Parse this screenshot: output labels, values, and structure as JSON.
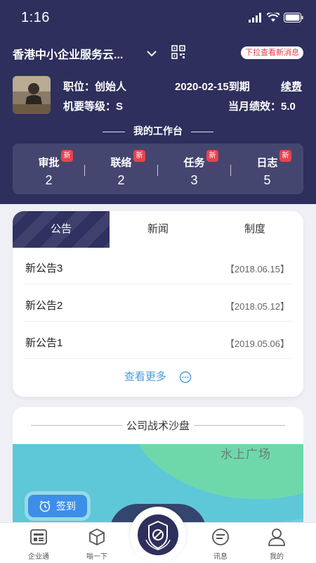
{
  "status_bar": {
    "time": "1:16"
  },
  "header": {
    "company_name": "香港中小企业服务云...",
    "pull_hint": "下拉查看新消息",
    "position_label": "职位：创始人",
    "expiry": "2020-02-15到期",
    "renew": "续费",
    "level_label": "机要等级：S",
    "performance_label": "当月绩效：5.0",
    "workbench_title": "我的工作台"
  },
  "stats": [
    {
      "label": "审批",
      "value": "2",
      "badge": "新"
    },
    {
      "label": "联络",
      "value": "2",
      "badge": "新"
    },
    {
      "label": "任务",
      "value": "3",
      "badge": "新"
    },
    {
      "label": "日志",
      "value": "5",
      "badge": "新"
    }
  ],
  "notice_tabs": [
    "公告",
    "新闻",
    "制度"
  ],
  "notices": [
    {
      "title": "新公告3",
      "date": "【2018.06.15】"
    },
    {
      "title": "新公告2",
      "date": "【2018.05.12】"
    },
    {
      "title": "新公告1",
      "date": "【2019.05.06】"
    }
  ],
  "view_more": "查看更多",
  "sandbox": {
    "title": "公司战术沙盘",
    "map_label": "水上广场",
    "checkin": "签到"
  },
  "tabbar": [
    {
      "label": "企业通",
      "icon": "enterprise-icon"
    },
    {
      "label": "嗡一下",
      "icon": "cube-icon"
    },
    {
      "label": "",
      "icon": "emblem-icon"
    },
    {
      "label": "讯息",
      "icon": "message-icon"
    },
    {
      "label": "我的",
      "icon": "profile-icon"
    }
  ],
  "colors": {
    "header_bg": "#2e2f5c",
    "badge_red": "#e8434f",
    "link_blue": "#4a9ad8",
    "map_water": "#5ec8d8",
    "map_land": "#6fd8aa"
  }
}
